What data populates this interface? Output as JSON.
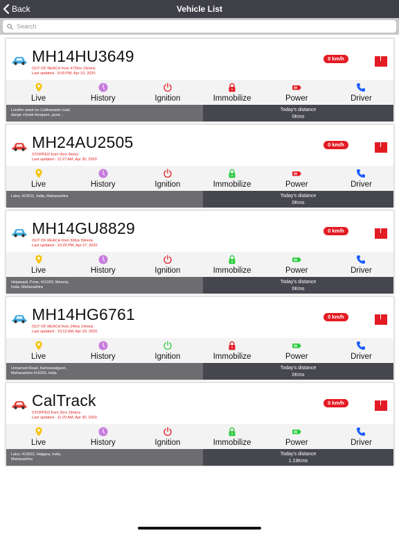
{
  "navbar": {
    "back_label": "Back",
    "title": "Vehicle List"
  },
  "search": {
    "placeholder": "Search"
  },
  "colors": {
    "navbar": "#3f3f47",
    "alert_red": "#e31b23",
    "car_blue": "#3aa7dc",
    "car_red": "#e53935",
    "live": "#f5c518",
    "history": "#c77dde",
    "success_green": "#2ecc40",
    "phone_blue": "#1a5cff"
  },
  "actions": {
    "live": "Live",
    "history": "History",
    "ignition": "Ignition",
    "immobilize": "Immobilize",
    "power": "Power",
    "driver": "Driver"
  },
  "distance_label": "Today's distance",
  "vehicles": [
    {
      "plate": "MH14HU3649",
      "car_color": "blue",
      "status": "OUT OF REACH from 473hrs 19mins",
      "updated": "Last updated - 5:09 PM, Apr 10, 2020",
      "speed": "0 km/h",
      "ignition": "red",
      "immobilize": "red",
      "power": "red",
      "address_line1": "Londhe wasti no.1,tathawade road,",
      "address_line2": "dange chowk thergaon ,pune...",
      "distance": "0Kms"
    },
    {
      "plate": "MH24AU2505",
      "car_color": "red",
      "status": "STOPPED from 0hrs 4mins",
      "updated": "Last updated - 11:27 AM, Apr 30, 2020",
      "speed": "0 km/h",
      "ignition": "red",
      "immobilize": "green",
      "power": "red",
      "address_line1": "Latur, 413511, India, Maharashtra",
      "address_line2": "",
      "distance": "0Kms"
    },
    {
      "plate": "MH14GU8829",
      "car_color": "blue",
      "status": "OUT OF REACH from 59hrs 59mins",
      "updated": "Last updated - 10:29 PM, Apr 27, 2020",
      "speed": "0 km/h",
      "ignition": "red",
      "immobilize": "green",
      "power": "green",
      "address_line1": "Hinjawadi, Pune, 411033, Marunji,",
      "address_line2": "India, Maharashtra",
      "distance": "0Kms"
    },
    {
      "plate": "MH14HG6761",
      "car_color": "blue",
      "status": "OUT OF REACH from 24hrs 14mins",
      "updated": "Last updated - 10:13 AM, Apr 29, 2020",
      "speed": "0 km/h",
      "ignition": "green",
      "immobilize": "red",
      "power": "green",
      "address_line1": "Unnamed Road, Karhewadgaon,",
      "address_line2": "Maharashtra 414203, India",
      "distance": "0Kms"
    },
    {
      "plate": "CalTrack",
      "car_color": "red",
      "status": "STOPPED from 2hrs 19mins",
      "updated": "Last updated - 11:29 AM, Apr 30, 2020",
      "speed": "0 km/h",
      "ignition": "red",
      "immobilize": "green",
      "power": "green",
      "address_line1": "Latur, 413522, Halgara, India,",
      "address_line2": "Maharashtra",
      "distance": "1.19Kms"
    }
  ]
}
